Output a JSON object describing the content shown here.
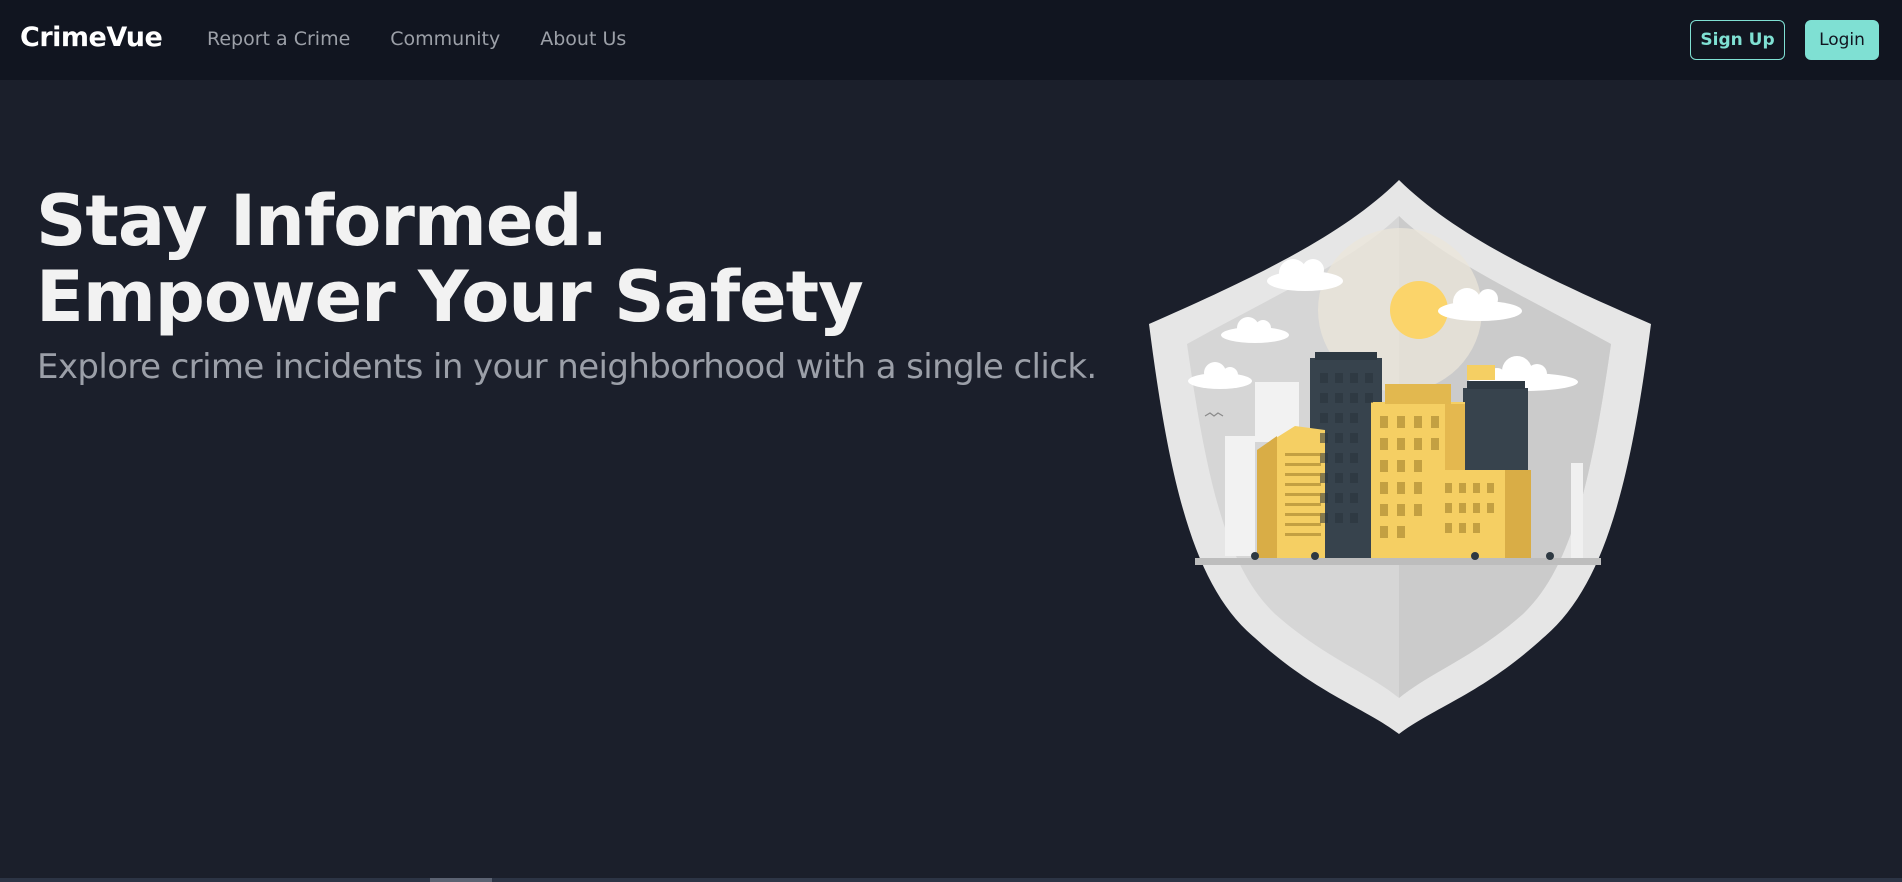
{
  "brand": {
    "name": "CrimeVue"
  },
  "nav": {
    "links": [
      {
        "label": "Report a Crime"
      },
      {
        "label": "Community"
      },
      {
        "label": "About Us"
      }
    ],
    "signup_label": "Sign Up",
    "login_label": "Login"
  },
  "hero": {
    "title_line1": "Stay Informed.",
    "title_line2": "Empower Your Safety",
    "subtitle": "Explore crime incidents in your neighborhood with a single click."
  },
  "illustration": {
    "icon": "city-shield-illustration"
  },
  "colors": {
    "background": "#1b1f2b",
    "navbar": "#111520",
    "accent": "#7fe0d3",
    "building_yellow": "#f5cf63",
    "building_dark": "#37434d"
  }
}
